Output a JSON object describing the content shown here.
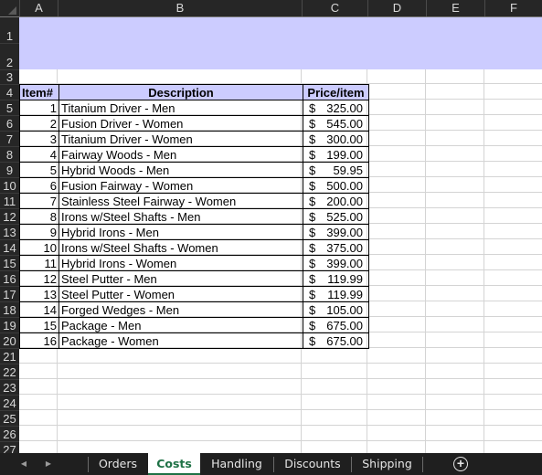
{
  "columns": [
    "A",
    "B",
    "C",
    "D",
    "E",
    "F"
  ],
  "rows": [
    "1",
    "2",
    "3",
    "4",
    "5",
    "6",
    "7",
    "8",
    "9",
    "10",
    "11",
    "12",
    "13",
    "14",
    "15",
    "16",
    "17",
    "18",
    "19",
    "20",
    "21",
    "22",
    "23",
    "24",
    "25",
    "26",
    "27"
  ],
  "table": {
    "headers": {
      "item": "Item#",
      "description": "Description",
      "price": "Price/item"
    },
    "currency_symbol": "$",
    "items": [
      {
        "item": "1",
        "description": "Titanium Driver - Men",
        "price": "325.00"
      },
      {
        "item": "2",
        "description": "Fusion Driver - Women",
        "price": "545.00"
      },
      {
        "item": "3",
        "description": "Titanium Driver - Women",
        "price": "300.00"
      },
      {
        "item": "4",
        "description": "Fairway Woods - Men",
        "price": "199.00"
      },
      {
        "item": "5",
        "description": "Hybrid Woods - Men",
        "price": "59.95"
      },
      {
        "item": "6",
        "description": "Fusion Fairway - Women",
        "price": "500.00"
      },
      {
        "item": "7",
        "description": "Stainless Steel Fairway - Women",
        "price": "200.00"
      },
      {
        "item": "8",
        "description": "Irons w/Steel Shafts - Men",
        "price": "525.00"
      },
      {
        "item": "9",
        "description": "Hybrid Irons - Men",
        "price": "399.00"
      },
      {
        "item": "10",
        "description": "Irons w/Steel Shafts - Women",
        "price": "375.00"
      },
      {
        "item": "11",
        "description": "Hybrid Irons - Women",
        "price": "399.00"
      },
      {
        "item": "12",
        "description": "Steel Putter - Men",
        "price": "119.99"
      },
      {
        "item": "13",
        "description": "Steel Putter - Women",
        "price": "119.99"
      },
      {
        "item": "14",
        "description": "Forged Wedges - Men",
        "price": "105.00"
      },
      {
        "item": "15",
        "description": "Package - Men",
        "price": "675.00"
      },
      {
        "item": "16",
        "description": "Package - Women",
        "price": "675.00"
      }
    ]
  },
  "tabs": {
    "nav_prev_icon": "◀",
    "nav_next_icon": "▶",
    "sheets": [
      "Orders",
      "Costs",
      "Handling",
      "Discounts",
      "Shipping"
    ],
    "active": "Costs",
    "add_icon": "+"
  },
  "colors": {
    "banner": "#ccccff",
    "header_fill": "#ccccff",
    "active_tab_text": "#1e7145"
  }
}
